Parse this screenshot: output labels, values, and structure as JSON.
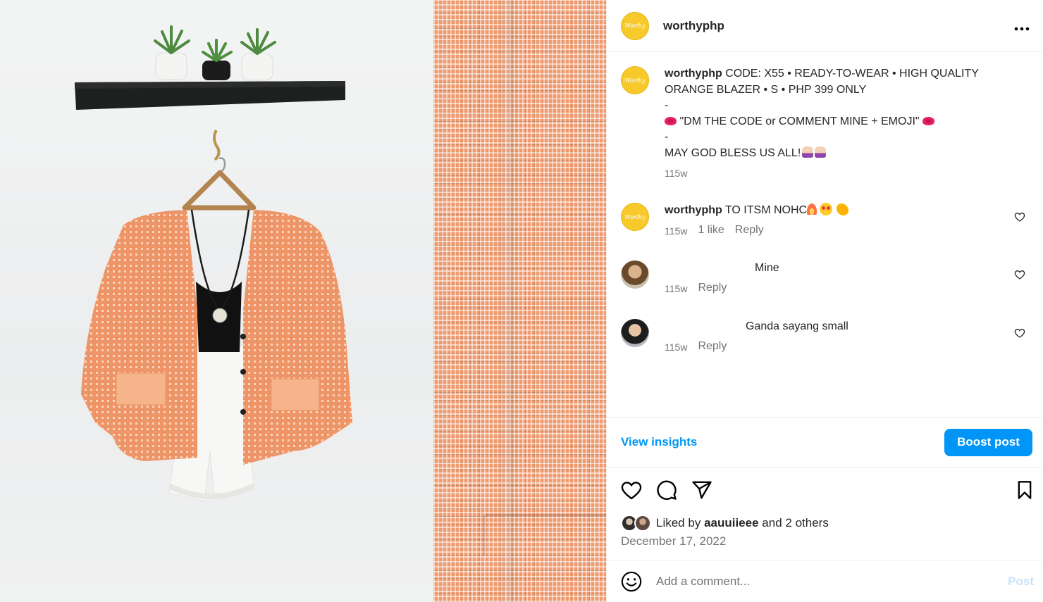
{
  "post": {
    "author": "worthyphp",
    "logo_text": "Worthy",
    "more_label": "•••"
  },
  "caption": {
    "user": "worthyphp",
    "line1": " CODE: X55 • READY-TO-WEAR • HIGH QUALITY ORANGE BLAZER • S • PHP 399 ONLY",
    "dash1": "-",
    "dm_text": "\"DM THE CODE or COMMENT MINE + EMOJI\"",
    "dash2": "-",
    "blessing": "MAY GOD BLESS US ALL!",
    "time": "115w"
  },
  "comments": [
    {
      "user": "worthyphp",
      "text": " TO ITSM            NOHC",
      "time": "115w",
      "likes": "1 like",
      "reply": "Reply"
    },
    {
      "user": "",
      "text": "Mine",
      "time": "115w",
      "reply": "Reply"
    },
    {
      "user": "",
      "text": "Ganda sayang small",
      "time": "115w",
      "reply": "Reply"
    }
  ],
  "insights": {
    "view_label": "View insights",
    "boost_label": "Boost post"
  },
  "engagement": {
    "liked_by_prefix": "Liked by ",
    "liked_by_user": "aauuiieee",
    "liked_by_suffix": " and ",
    "others": "2 others",
    "date": "December 17, 2022"
  },
  "composer": {
    "placeholder": "Add a comment...",
    "post_label": "Post"
  },
  "colors": {
    "accent": "#0095f6",
    "logo": "#f7c92a"
  }
}
